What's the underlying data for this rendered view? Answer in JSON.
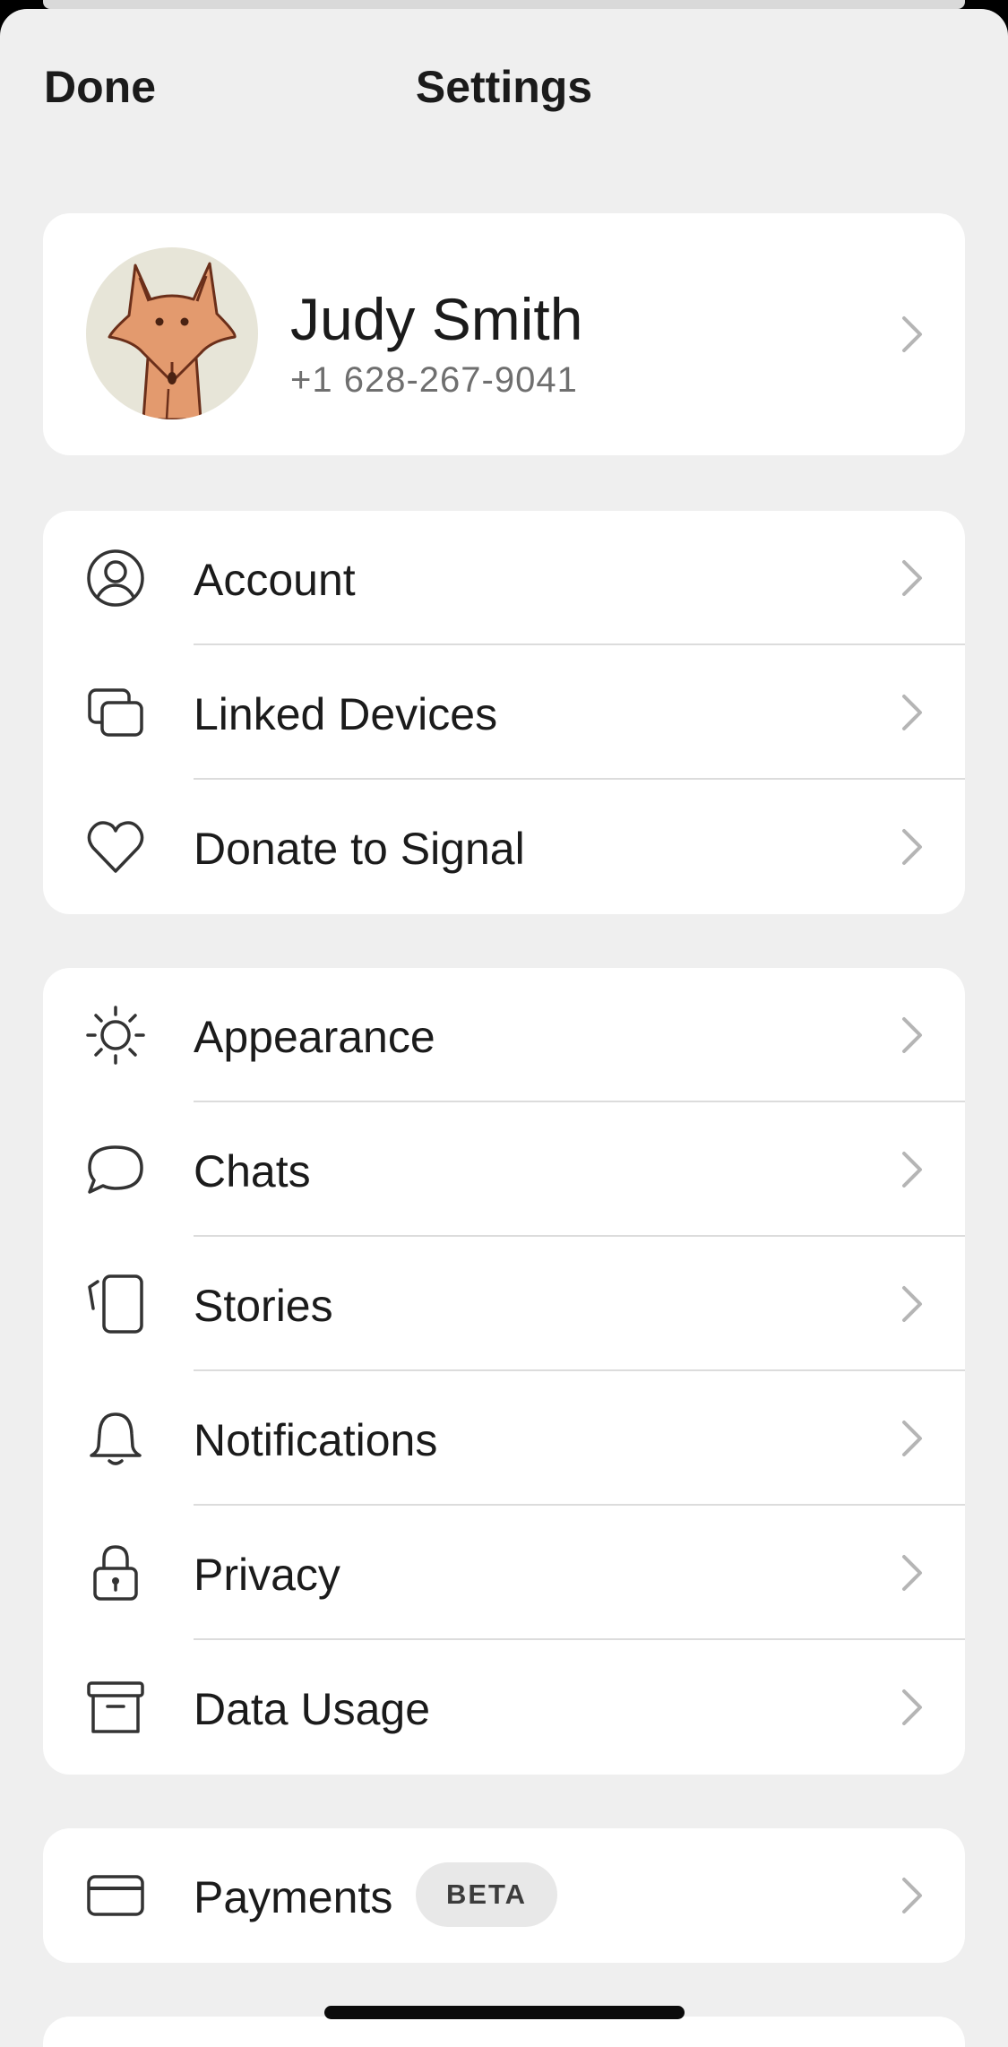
{
  "nav": {
    "done_label": "Done",
    "title": "Settings"
  },
  "profile": {
    "name": "Judy Smith",
    "phone": "+1 628-267-9041",
    "avatar_icon": "fox-avatar-icon"
  },
  "groups": [
    {
      "items": [
        {
          "label": "Account",
          "icon": "person-circle-icon"
        },
        {
          "label": "Linked Devices",
          "icon": "linked-devices-icon"
        },
        {
          "label": "Donate to Signal",
          "icon": "heart-icon"
        }
      ]
    },
    {
      "items": [
        {
          "label": "Appearance",
          "icon": "sun-icon"
        },
        {
          "label": "Chats",
          "icon": "chat-bubble-icon"
        },
        {
          "label": "Stories",
          "icon": "stories-icon"
        },
        {
          "label": "Notifications",
          "icon": "bell-icon"
        },
        {
          "label": "Privacy",
          "icon": "lock-icon"
        },
        {
          "label": "Data Usage",
          "icon": "archive-box-icon"
        }
      ]
    },
    {
      "items": [
        {
          "label": "Payments",
          "icon": "credit-card-icon",
          "badge": "BETA"
        }
      ]
    }
  ],
  "colors": {
    "background": "#efefef",
    "card": "#ffffff",
    "text": "#1b1b1b",
    "secondary_text": "#6f6f6f",
    "chevron": "#b5b5b5",
    "avatar_bg": "#e7e5d8",
    "fox": "#e39a6e"
  }
}
